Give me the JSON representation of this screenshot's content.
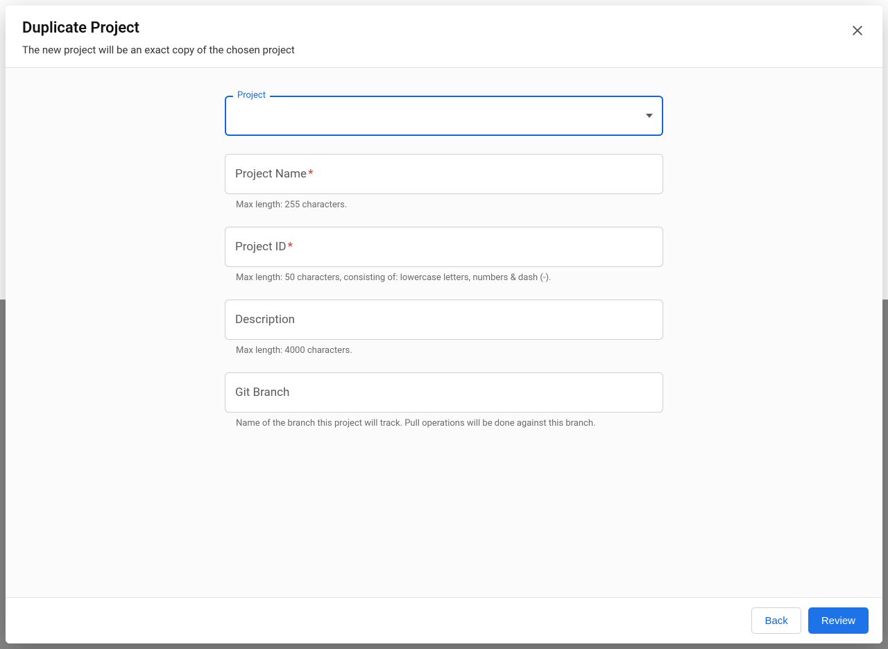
{
  "modal": {
    "title": "Duplicate Project",
    "subtitle": "The new project will be an exact copy of the chosen project"
  },
  "form": {
    "project": {
      "label": "Project",
      "value": ""
    },
    "projectName": {
      "label": "Project Name",
      "required": true,
      "helper": "Max length: 255 characters."
    },
    "projectId": {
      "label": "Project ID",
      "required": true,
      "helper": "Max length: 50 characters, consisting of: lowercase letters, numbers & dash (-)."
    },
    "description": {
      "label": "Description",
      "helper": "Max length: 4000 characters."
    },
    "gitBranch": {
      "label": "Git Branch",
      "helper": "Name of the branch this project will track. Pull operations will be done against this branch."
    }
  },
  "footer": {
    "back": "Back",
    "review": "Review"
  }
}
